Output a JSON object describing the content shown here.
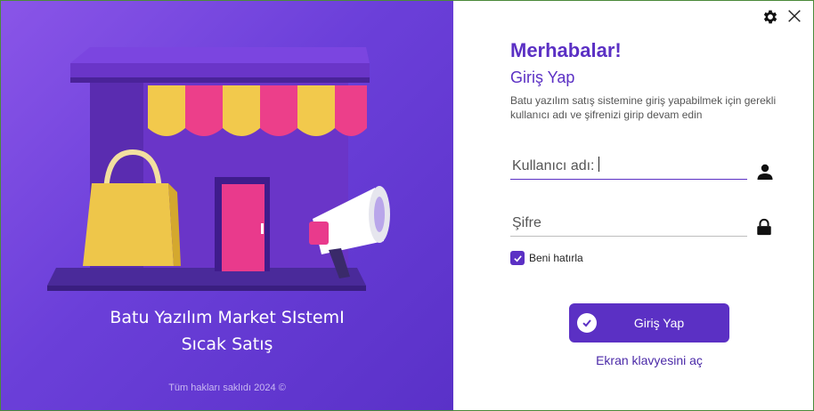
{
  "left_panel": {
    "brand_line1": "Batu Yazılım Market SIstemI",
    "brand_line2": "Sıcak Satış",
    "copyright": "Tüm hakları saklıdı 2024 ©",
    "illustration_icon": "store-with-shopping-bag-and-megaphone"
  },
  "header": {
    "settings_icon": "gear-icon",
    "close_icon": "close-icon"
  },
  "login": {
    "welcome": "Merhabalar!",
    "subtitle": "Giriş Yap",
    "description": "Batu yazılım satış sistemine giriş yapabilmek için gerekli kullanıcı adı ve şifrenizi girip devam edin",
    "username_placeholder": "Kullanıcı adı:",
    "username_value": "",
    "password_placeholder": "Şifre",
    "password_value": "",
    "remember_me_label": "Beni hatırla",
    "remember_me_checked": true,
    "login_button_label": "Giriş Yap",
    "keyboard_link": "Ekran klavyesini aç"
  },
  "colors": {
    "accent": "#5b30c4",
    "left_gradient_start": "#8a55e8",
    "left_gradient_end": "#5a31c8"
  }
}
